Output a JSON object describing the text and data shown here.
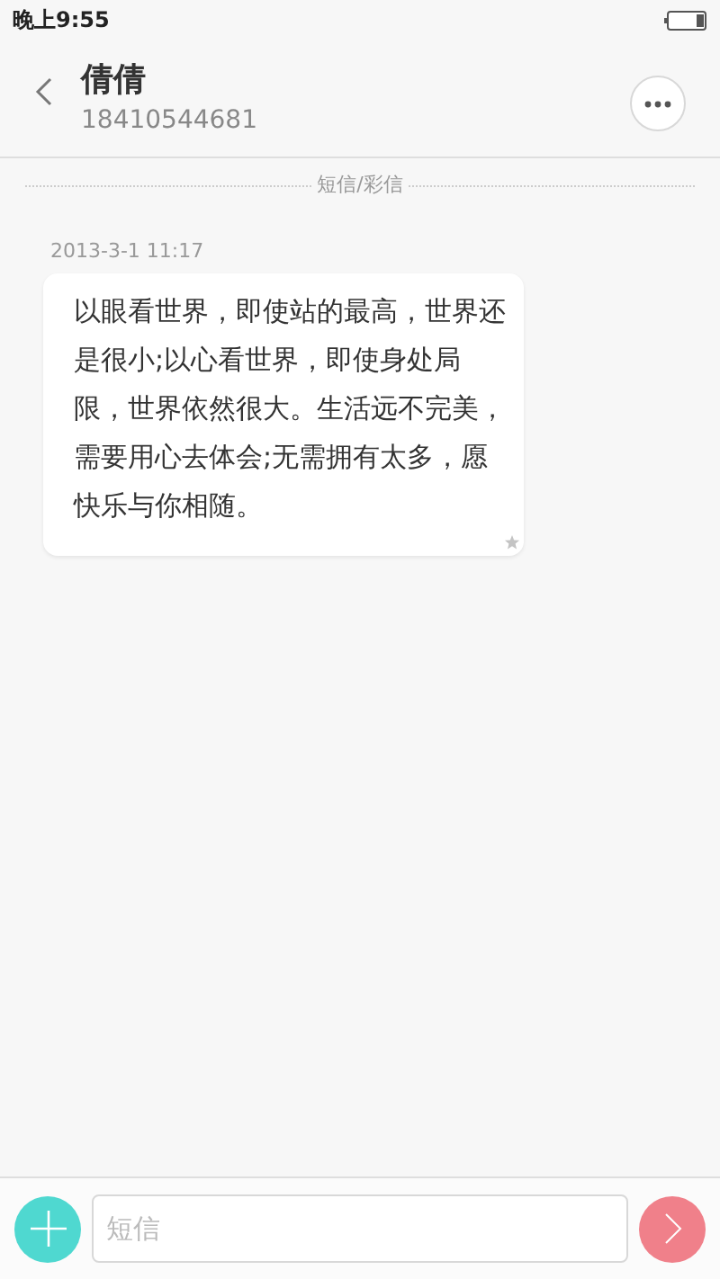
{
  "status_bar": {
    "time": "晚上9:55"
  },
  "header": {
    "name": "倩倩",
    "number": "18410544681"
  },
  "section_label": "短信/彩信",
  "messages": [
    {
      "time": "2013-3-1 11:17",
      "text": "以眼看世界，即使站的最高，世界还是很小;以心看世界，即使身处局限，世界依然很大。生活远不完美，需要用心去体会;无需拥有太多，愿快乐与你相随。",
      "starred": false
    }
  ],
  "composer": {
    "placeholder": "短信"
  }
}
